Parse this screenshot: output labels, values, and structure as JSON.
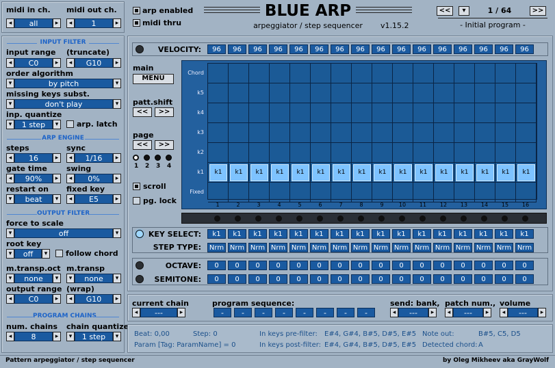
{
  "header": {
    "midi_in_label": "midi in ch.",
    "midi_in_value": "all",
    "midi_out_label": "midi out ch.",
    "midi_out_value": "1",
    "arp_enabled_label": "arp enabled",
    "midi_thru_label": "midi thru",
    "title": "BLUE ARP",
    "subtitle": "arpeggiator / step sequencer",
    "version": "v1.15.2",
    "program_counter": "1 / 64",
    "program_name": "- Initial program -"
  },
  "input_filter": {
    "section": "INPUT FILTER",
    "input_range_label": "input range",
    "truncate_label": "(truncate)",
    "range_low": "C0",
    "range_high": "G10",
    "order_label": "order algorithm",
    "order_value": "by pitch",
    "missing_label": "missing keys subst.",
    "missing_value": "don't play",
    "quantize_label": "inp. quantize",
    "quantize_value": "1 step",
    "arp_latch_label": "arp. latch"
  },
  "arp_engine": {
    "section": "ARP ENGINE",
    "steps_label": "steps",
    "steps_value": "16",
    "sync_label": "sync",
    "sync_value": "1/16",
    "gate_label": "gate time",
    "gate_value": "90%",
    "swing_label": "swing",
    "swing_value": "0%",
    "restart_label": "restart on",
    "restart_value": "beat",
    "fixed_key_label": "fixed key",
    "fixed_key_value": "E5"
  },
  "output_filter": {
    "section": "OUTPUT FILTER",
    "force_label": "force to scale",
    "force_value": "off",
    "root_label": "root key",
    "root_value": "off",
    "follow_label": "follow chord",
    "transp_oct_label": "m.transp.oct",
    "transp_oct_value": "none",
    "transp_label": "m.transp",
    "transp_value": "none",
    "out_range_label": "output range",
    "wrap_label": "(wrap)",
    "out_low": "C0",
    "out_high": "G10"
  },
  "program_chains": {
    "section": "PROGRAM CHAINS",
    "num_label": "num. chains",
    "num_value": "8",
    "cq_label": "chain quantize",
    "cq_value": "1 step"
  },
  "sequencer": {
    "velocity_label": "VELOCITY:",
    "velocity": [
      "96",
      "96",
      "96",
      "96",
      "96",
      "96",
      "96",
      "96",
      "96",
      "96",
      "96",
      "96",
      "96",
      "96",
      "96",
      "96"
    ],
    "main_label": "main",
    "menu_label": "MENU",
    "patt_shift_label": "patt.shift",
    "shift_left": "<<",
    "shift_right": ">>",
    "page_label": "page",
    "page_left": "<<",
    "page_right": ">>",
    "page_numbers": [
      "1",
      "2",
      "3",
      "4"
    ],
    "scroll_label": "scroll",
    "pg_lock_label": "pg. lock",
    "row_labels": [
      "Chord",
      "k5",
      "k4",
      "k3",
      "k2",
      "k1",
      "Fixed"
    ],
    "step_numbers": [
      "1",
      "2",
      "3",
      "4",
      "5",
      "6",
      "7",
      "8",
      "9",
      "10",
      "11",
      "12",
      "13",
      "14",
      "15",
      "16"
    ],
    "k1_cell": "k1",
    "key_select_label": "KEY SELECT:",
    "key_select": [
      "k1",
      "k1",
      "k1",
      "k1",
      "k1",
      "k1",
      "k1",
      "k1",
      "k1",
      "k1",
      "k1",
      "k1",
      "k1",
      "k1",
      "k1",
      "k1"
    ],
    "step_type_label": "STEP TYPE:",
    "step_type": [
      "Nrm",
      "Nrm",
      "Nrm",
      "Nrm",
      "Nrm",
      "Nrm",
      "Nrm",
      "Nrm",
      "Nrm",
      "Nrm",
      "Nrm",
      "Nrm",
      "Nrm",
      "Nrm",
      "Nrm",
      "Nrm"
    ],
    "octave_label": "OCTAVE:",
    "octave": [
      "0",
      "0",
      "0",
      "0",
      "0",
      "0",
      "0",
      "0",
      "0",
      "0",
      "0",
      "0",
      "0",
      "0",
      "0",
      "0"
    ],
    "semitone_label": "SEMITONE:",
    "semitone": [
      "0",
      "0",
      "0",
      "0",
      "0",
      "0",
      "0",
      "0",
      "0",
      "0",
      "0",
      "0",
      "0",
      "0",
      "0",
      "0"
    ]
  },
  "chain": {
    "current_label": "current chain",
    "current_value": "---",
    "sequence_label": "program sequence:",
    "sequence": [
      "-",
      "-",
      "-",
      "-",
      "-",
      "-",
      "-",
      "-"
    ],
    "bank_label": "send: bank,",
    "bank_value": "---",
    "patch_label": "patch num.,",
    "patch_value": "---",
    "volume_label": "volume",
    "volume_value": "---"
  },
  "status": {
    "beat": "Beat: 0,00",
    "step": "Step: 0",
    "param": "Param [Tag: ParamName] = 0",
    "pre_label": "In keys pre-filter:",
    "pre_value": "E#4, G#4, B#5, D#5, E#5",
    "post_label": "In keys post-filter:",
    "post_value": "E#4, G#4, B#5, D#5, E#5",
    "note_out_label": "Note out:",
    "note_out_value": "B#5, C5, D5",
    "detected_label": "Detected chord:",
    "detected_value": "A"
  },
  "footer": {
    "left": "Pattern arpeggiator / step sequencer",
    "right": "by Oleg Mikheev aka GrayWolf"
  }
}
